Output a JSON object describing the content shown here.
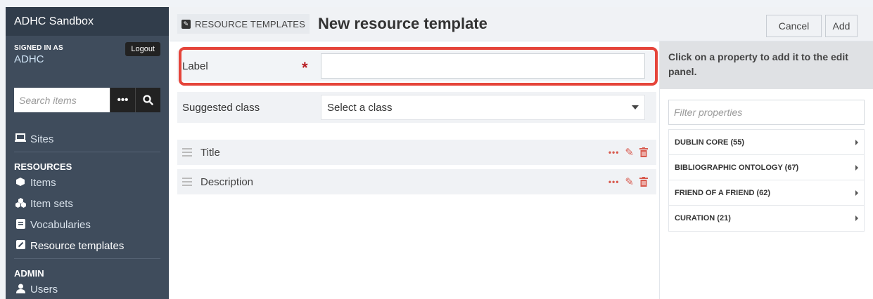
{
  "sidebar": {
    "site_title": "ADHC Sandbox",
    "signed_in_as": "SIGNED IN AS",
    "user_name": "ADHC",
    "logout_label": "Logout",
    "search_placeholder": "Search items",
    "nav": {
      "sites": "Sites",
      "resources_heading": "RESOURCES",
      "items": "Items",
      "item_sets": "Item sets",
      "vocabularies": "Vocabularies",
      "resource_templates": "Resource templates",
      "admin_heading": "ADMIN",
      "users": "Users"
    }
  },
  "header": {
    "breadcrumb": "RESOURCE TEMPLATES",
    "title": "New resource template",
    "cancel_label": "Cancel",
    "add_label": "Add"
  },
  "form": {
    "label_field": {
      "label": "Label",
      "required_mark": "*",
      "value": ""
    },
    "class_field": {
      "label": "Suggested class",
      "selected": "Select a class"
    }
  },
  "properties": [
    {
      "name": "Title"
    },
    {
      "name": "Description"
    }
  ],
  "panel": {
    "instruction": "Click on a property to add it to the edit panel.",
    "filter_placeholder": "Filter properties",
    "vocabularies": [
      {
        "label": "DUBLIN CORE (55)"
      },
      {
        "label": "BIBLIOGRAPHIC ONTOLOGY (67)"
      },
      {
        "label": "FRIEND OF A FRIEND (62)"
      },
      {
        "label": "CURATION (21)"
      }
    ]
  },
  "colors": {
    "sidebar_bg": "#3f4c5c",
    "highlight": "#e5443a",
    "required": "#b81f24",
    "action_icons": "#d85a4e"
  }
}
